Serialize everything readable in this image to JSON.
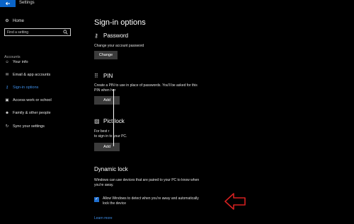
{
  "window": {
    "title": "Settings"
  },
  "sidebar": {
    "home_label": "Home",
    "search_placeholder": "Find a setting",
    "section_label": "Accounts",
    "items": [
      {
        "label": "Your info",
        "icon": "person-icon"
      },
      {
        "label": "Email & app accounts",
        "icon": "mail-icon"
      },
      {
        "label": "Sign-in options",
        "icon": "key-icon",
        "active": true
      },
      {
        "label": "Access work or school",
        "icon": "briefcase-icon"
      },
      {
        "label": "Family & other people",
        "icon": "people-icon"
      },
      {
        "label": "Sync your settings",
        "icon": "sync-icon"
      }
    ]
  },
  "main": {
    "title": "Sign-in options",
    "password": {
      "title": "Password",
      "desc": "Change your account password",
      "button": "Change"
    },
    "pin": {
      "title": "PIN",
      "desc_line1": "Create a PIN to use in place of passwords. You'll be asked for this",
      "desc_line2": "PIN when     her",
      "button": "Add"
    },
    "picture": {
      "title": "Pict    lock",
      "desc_line1": "For best r",
      "desc_line2": "to sign in to your PC.",
      "button": "Add"
    },
    "dynamic_lock": {
      "title": "Dynamic lock",
      "desc_line1": "Windows can use devices that are paired to your PC to know when",
      "desc_line2": "you're away.",
      "checkbox_line1": "Allow Windows to detect when you're away and automatically",
      "checkbox_line2": "lock the device",
      "checked": true,
      "link": "Learn more"
    }
  },
  "colors": {
    "accent": "#3d8ee8",
    "back_button": "#0a64c8",
    "annotation_arrow": "#d42020"
  }
}
